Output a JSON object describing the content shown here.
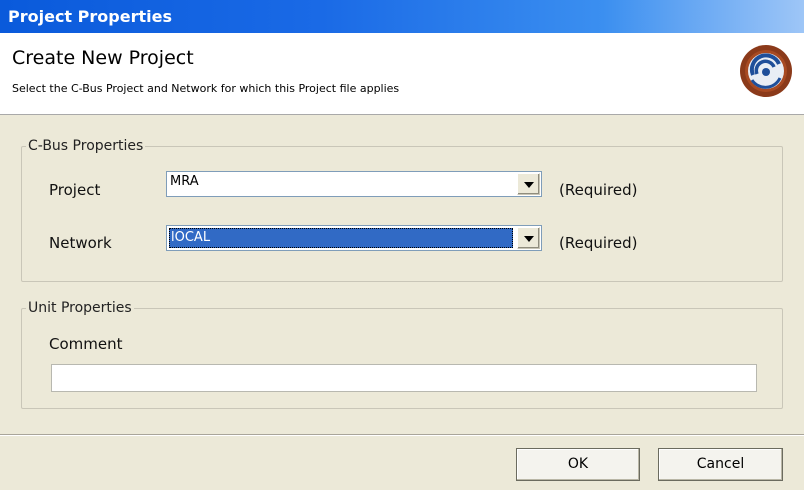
{
  "window": {
    "title": "Project Properties"
  },
  "header": {
    "title": "Create New Project",
    "subtitle": "Select  the C-Bus Project and Network for which this Project file applies",
    "logo_icon": "c-bus-logo-icon"
  },
  "cbus_properties": {
    "legend": "C-Bus Properties",
    "project": {
      "label": "Project",
      "value": "MRA",
      "required": "(Required)"
    },
    "network": {
      "label": "Network",
      "value": "lOCAL",
      "required": "(Required)"
    }
  },
  "unit_properties": {
    "legend": "Unit Properties",
    "comment": {
      "label": "Comment",
      "value": ""
    }
  },
  "buttons": {
    "ok": "OK",
    "cancel": "Cancel"
  },
  "colors": {
    "titlebar": "#0a5adb",
    "selection": "#316ac5",
    "logo": "#8b3a1a"
  }
}
